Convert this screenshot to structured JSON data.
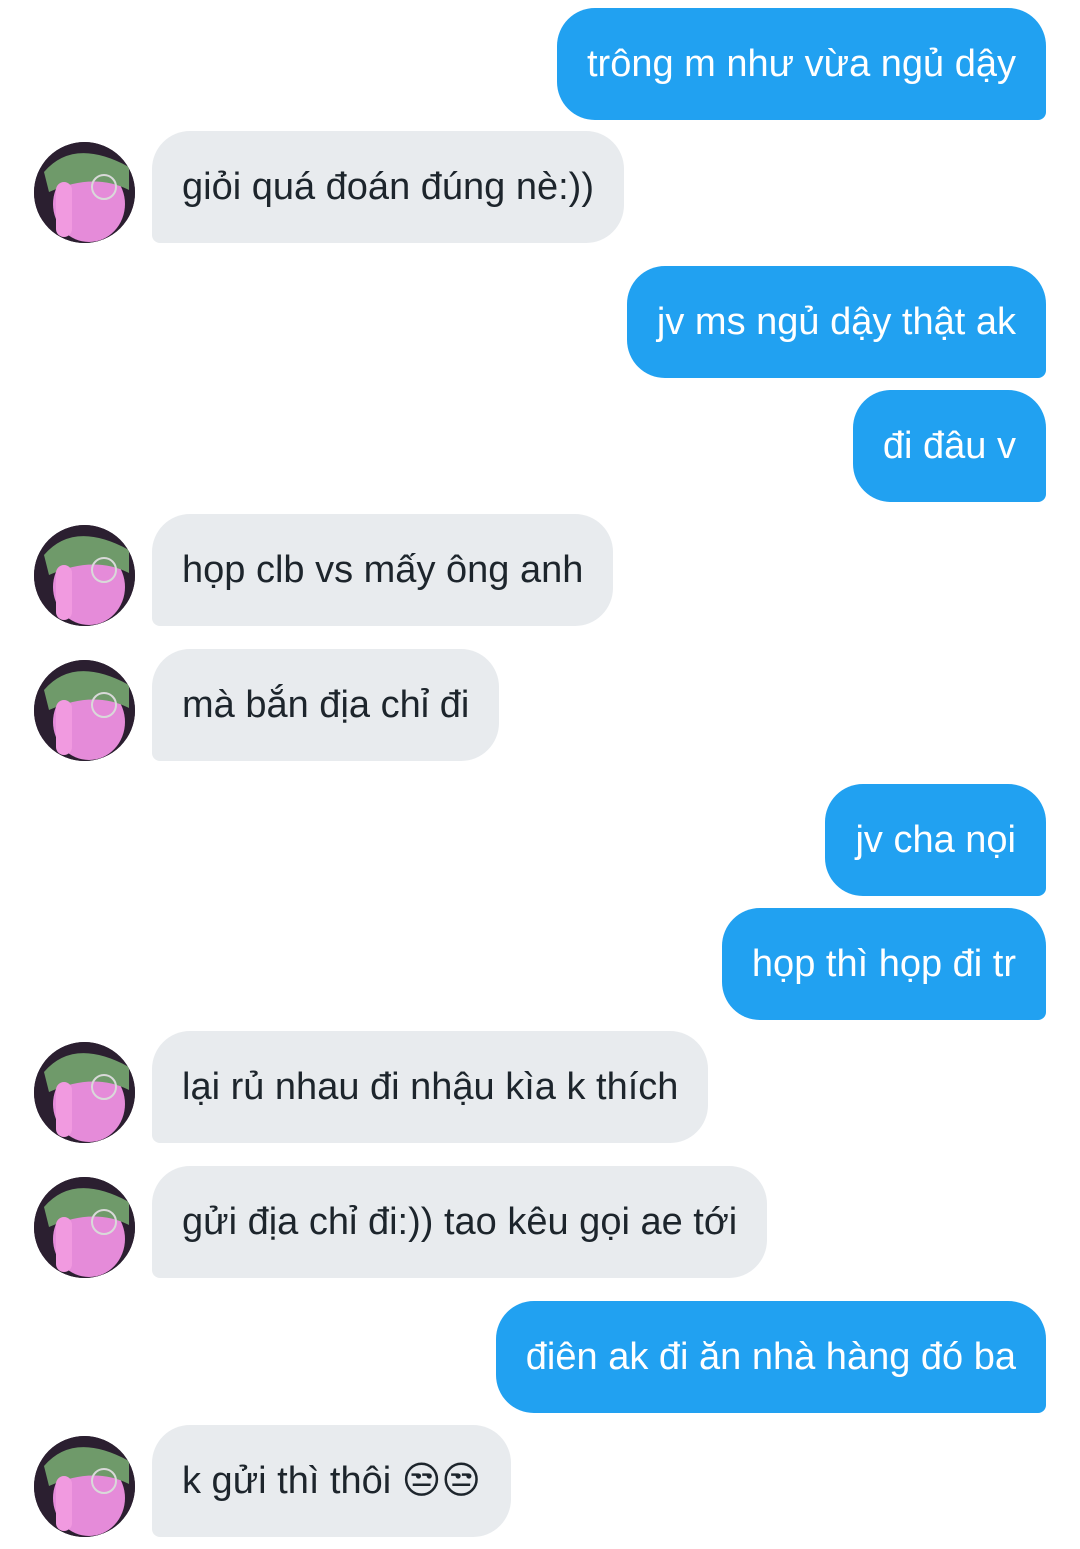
{
  "conversation": {
    "messages": [
      {
        "side": "sent",
        "text": "trông m như vừa ngủ dậy"
      },
      {
        "side": "received",
        "text": "giỏi quá đoán đúng nè:))"
      },
      {
        "side": "sent",
        "text": "jv ms ngủ dậy thật ak"
      },
      {
        "side": "sent",
        "text": "đi đâu v"
      },
      {
        "side": "received",
        "text": "họp clb vs mấy ông anh"
      },
      {
        "side": "received",
        "text": "mà bắn địa chỉ đi"
      },
      {
        "side": "sent",
        "text": "jv cha nọi"
      },
      {
        "side": "sent",
        "text": "họp thì họp đi tr"
      },
      {
        "side": "received",
        "text": "lại rủ nhau đi nhậu kìa k thích"
      },
      {
        "side": "received",
        "text": "gửi địa chỉ đi:)) tao kêu gọi ae tới"
      },
      {
        "side": "sent",
        "text": "điên ak đi ăn nhà hàng đó ba"
      },
      {
        "side": "received",
        "text": "k gửi thì thôi 😒😒"
      }
    ]
  },
  "colors": {
    "sent_bubble": "#21a1f1",
    "received_bubble": "#e8ebee",
    "sent_text": "#ffffff",
    "received_text": "#1d252c"
  },
  "icons": {
    "contact_avatar": "avatar-photo"
  }
}
